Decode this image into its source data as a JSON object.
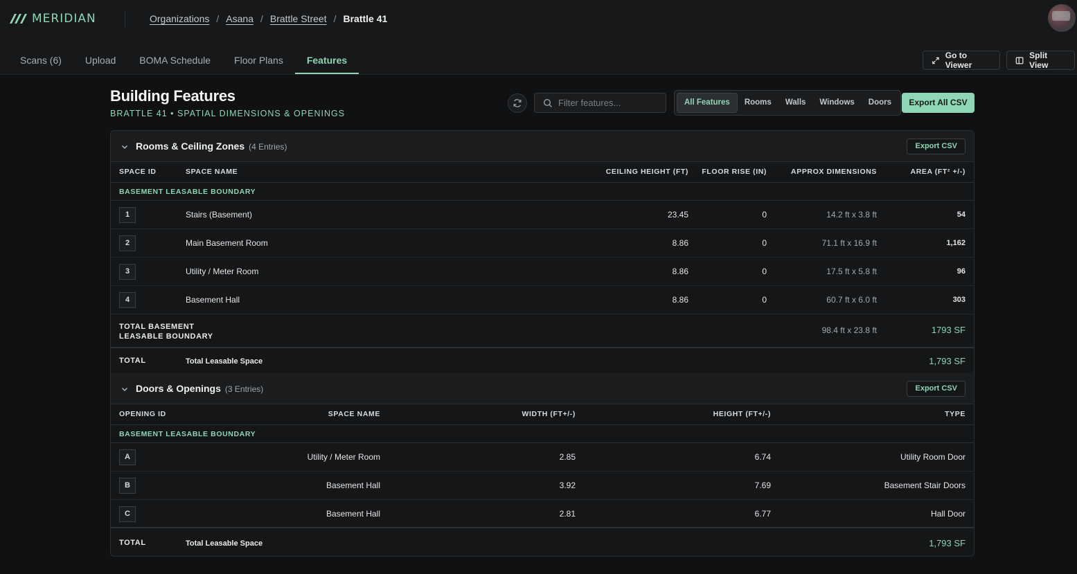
{
  "app": {
    "logo_text": "MERIDIAN",
    "accent": "#8fd6b4"
  },
  "breadcrumb": [
    "Organizations",
    "Asana",
    "Brattle Street",
    "Brattle 41"
  ],
  "tabs": [
    "Scans (6)",
    "Upload",
    "BOMA Schedule",
    "Floor Plans",
    "Features"
  ],
  "active_tab": "Features",
  "header_actions": {
    "viewer": "Go to Viewer",
    "split": "Split View"
  },
  "page": {
    "title": "Building Features",
    "subtitle": "BRATTLE 41 • SPATIAL DIMENSIONS & OPENINGS"
  },
  "search": {
    "placeholder": "Filter features..."
  },
  "filters": [
    "All Features",
    "Rooms",
    "Walls",
    "Windows",
    "Doors"
  ],
  "active_filter": "All Features",
  "export_all": "Export All CSV",
  "rooms": {
    "title": "Rooms & Ceiling Zones",
    "count": "(4 Entries)",
    "export": "Export CSV",
    "columns": [
      "SPACE ID",
      "SPACE NAME",
      "CEILING HEIGHT (FT)",
      "FLOOR RISE (IN)",
      "APPROX DIMENSIONS",
      "AREA (FT² +/-)"
    ],
    "group": "BASEMENT LEASABLE BOUNDARY",
    "rows": [
      {
        "id": "1",
        "name": "Stairs (Basement)",
        "ceiling": "23.45",
        "rise": "0",
        "dims": "14.2 ft x 3.8 ft",
        "area": "54"
      },
      {
        "id": "2",
        "name": "Main Basement Room",
        "ceiling": "8.86",
        "rise": "0",
        "dims": "71.1 ft x 16.9 ft",
        "area": "1,162"
      },
      {
        "id": "3",
        "name": "Utility  / Meter Room",
        "ceiling": "8.86",
        "rise": "0",
        "dims": "17.5 ft x 5.8 ft",
        "area": "96"
      },
      {
        "id": "4",
        "name": "Basement Hall",
        "ceiling": "8.86",
        "rise": "0",
        "dims": "60.7 ft x 6.0 ft",
        "area": "303"
      }
    ],
    "subtotal": {
      "label_line1": "TOTAL BASEMENT",
      "label_line2": "LEASABLE BOUNDARY",
      "dims": "98.4 ft x 23.8 ft",
      "area": "1793 SF"
    },
    "total": {
      "label": "TOTAL",
      "name": "Total Leasable Space",
      "value": "1,793 SF"
    }
  },
  "doors": {
    "title": "Doors & Openings",
    "count": "(3 Entries)",
    "export": "Export CSV",
    "columns": [
      "OPENING ID",
      "SPACE NAME",
      "WIDTH (FT+/-)",
      "HEIGHT (FT+/-)",
      "TYPE"
    ],
    "group": "BASEMENT LEASABLE BOUNDARY",
    "rows": [
      {
        "id": "A",
        "space": "Utility  / Meter Room",
        "width": "2.85",
        "height": "6.74",
        "type": "Utility Room Door"
      },
      {
        "id": "B",
        "space": "Basement Hall",
        "width": "3.92",
        "height": "7.69",
        "type": "Basement Stair Doors"
      },
      {
        "id": "C",
        "space": "Basement Hall",
        "width": "2.81",
        "height": "6.77",
        "type": "Hall Door"
      }
    ],
    "total": {
      "label": "TOTAL",
      "name": "Total Leasable Space",
      "value": "1,793 SF"
    }
  }
}
